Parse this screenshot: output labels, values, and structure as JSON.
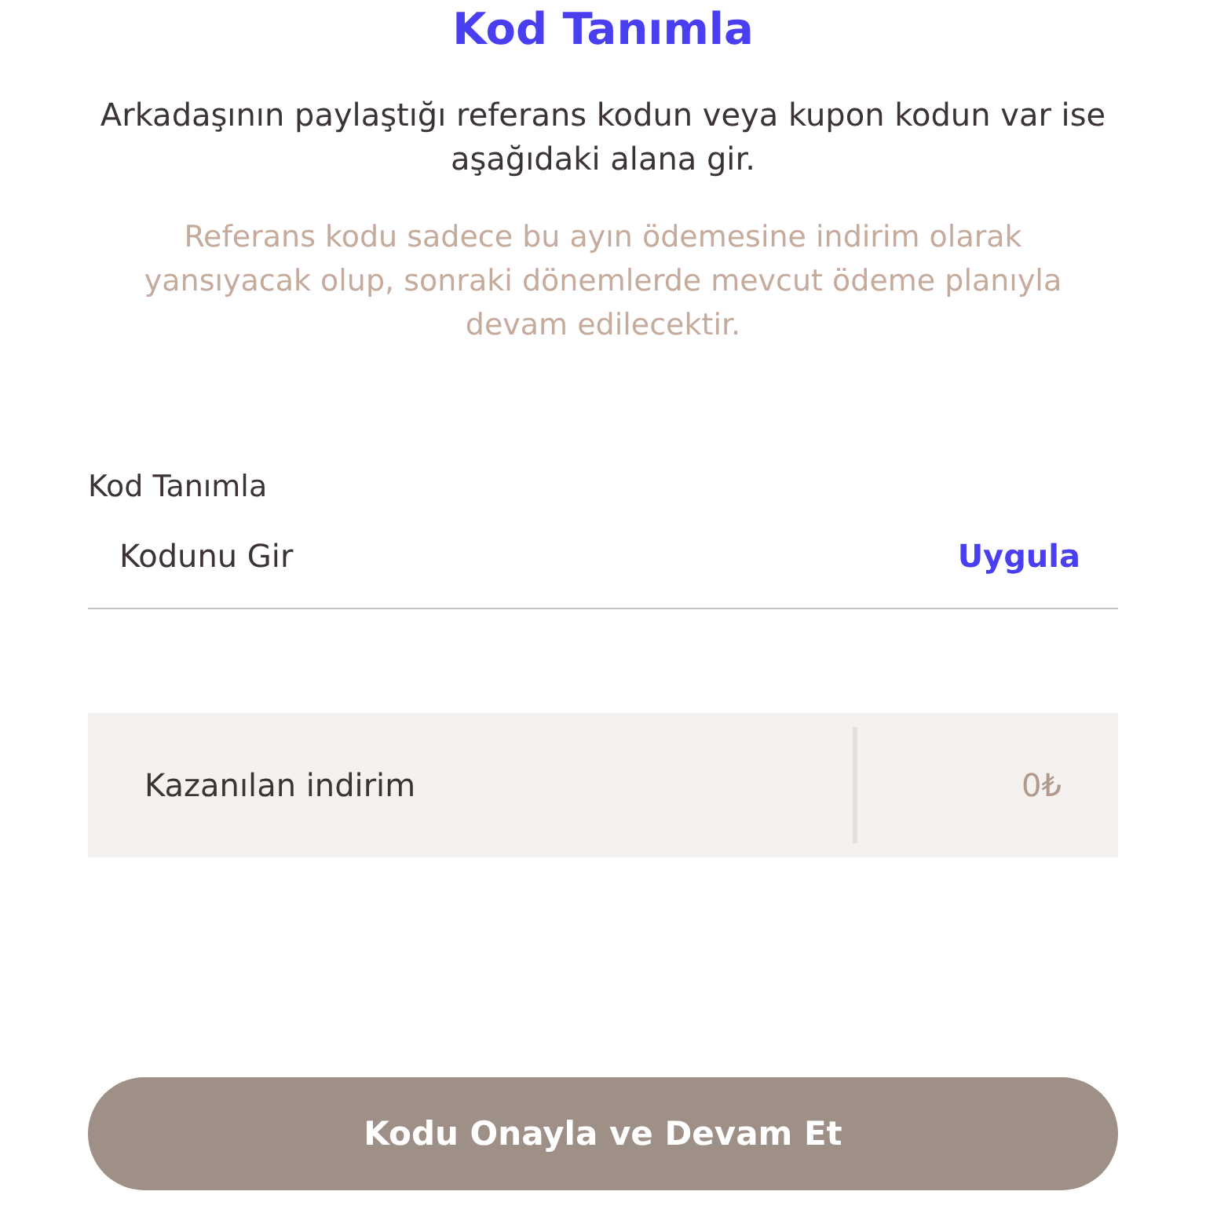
{
  "title": "Kod Tanımla",
  "description": "Arkadaşının paylaştığı referans kodun veya kupon kodun var ise aşağıdaki alana gir.",
  "note": "Referans kodu sadece bu ayın ödemesine indirim olarak yansıyacak olup, sonraki dönemlerde mevcut ödeme planıyla devam edilecektir.",
  "code_field": {
    "label": "Kod Tanımla",
    "placeholder": "Kodunu Gir",
    "apply": "Uygula"
  },
  "discount": {
    "label": "Kazanılan indirim",
    "value": "0₺"
  },
  "confirm_button": {
    "label": "Kodu Onayla ve Devam Et",
    "disabled": true
  }
}
